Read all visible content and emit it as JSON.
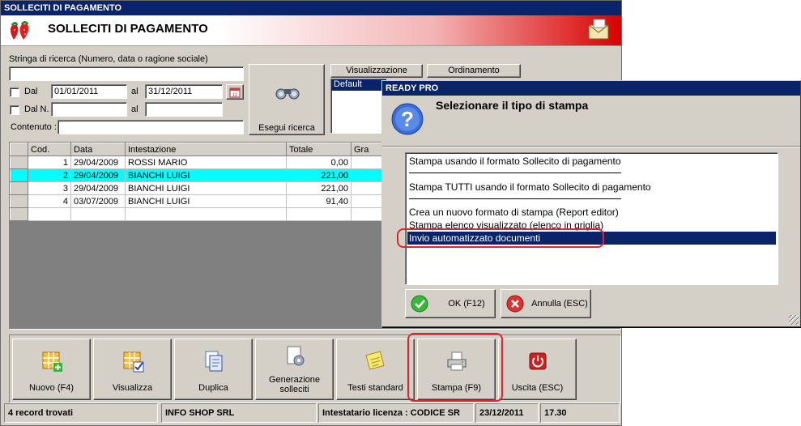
{
  "window": {
    "title": "SOLLECITI DI PAGAMENTO",
    "banner_title": "SOLLECITI DI PAGAMENTO"
  },
  "search": {
    "label": "Stringa di ricerca (Numero, data o ragione sociale)",
    "value": "",
    "dal_label": "Dal",
    "date_from": "01/01/2011",
    "al_label": "al",
    "date_to": "31/12/2011",
    "daln_label": "Dal N.",
    "num_from": "",
    "al2_label": "al",
    "num_to": "",
    "contenuto_label": "Contenuto :",
    "contenuto_value": "",
    "exec_button": "Esegui ricerca"
  },
  "tabs": {
    "visualizzazione": "Visualizzazione",
    "ordinamento": "Ordinamento",
    "list_item": "Default"
  },
  "grid": {
    "headers": [
      "Cod.",
      "Data",
      "Intestazione",
      "Totale",
      "Gra"
    ],
    "rows": [
      {
        "cod": "1",
        "data": "29/04/2009",
        "intestazione": "ROSSI MARIO",
        "totale": "0,00"
      },
      {
        "cod": "2",
        "data": "29/04/2009",
        "intestazione": "BIANCHI LUIGI",
        "totale": "221,00"
      },
      {
        "cod": "3",
        "data": "29/04/2009",
        "intestazione": "BIANCHI LUIGI",
        "totale": "221,00"
      },
      {
        "cod": "4",
        "data": "03/07/2009",
        "intestazione": "BIANCHI LUIGI",
        "totale": "91,40"
      }
    ]
  },
  "toolbar": {
    "nuovo": "Nuovo (F4)",
    "visualizza": "Visualizza",
    "duplica": "Duplica",
    "generazione1": "Generazione",
    "generazione2": "solleciti",
    "testi": "Testi standard",
    "stampa": "Stampa (F9)",
    "uscita": "Uscita (ESC)"
  },
  "statusbar": {
    "records": "4 record trovati",
    "company": "INFO SHOP SRL",
    "license": "Intestatario licenza : CODICE SR",
    "date": "23/12/2011",
    "time": "17.30"
  },
  "dialog": {
    "title": "READY PRO",
    "heading": "Selezionare il tipo di stampa",
    "options": [
      "Stampa usando il formato Sollecito di pagamento",
      "Stampa TUTTI usando il formato Sollecito di pagamento",
      "Crea un nuovo formato di stampa (Report editor)",
      "Stampa elenco visualizzato (elenco in griglia)",
      "Invio automatizzato documenti"
    ],
    "ok_button": "OK (F12)",
    "cancel_button": "Annulla (ESC)"
  },
  "colors": {
    "titlebar": "#0a246a",
    "selection_row": "#00ffff",
    "highlight_ring": "#e0242c",
    "banner_red": "#d90000"
  }
}
